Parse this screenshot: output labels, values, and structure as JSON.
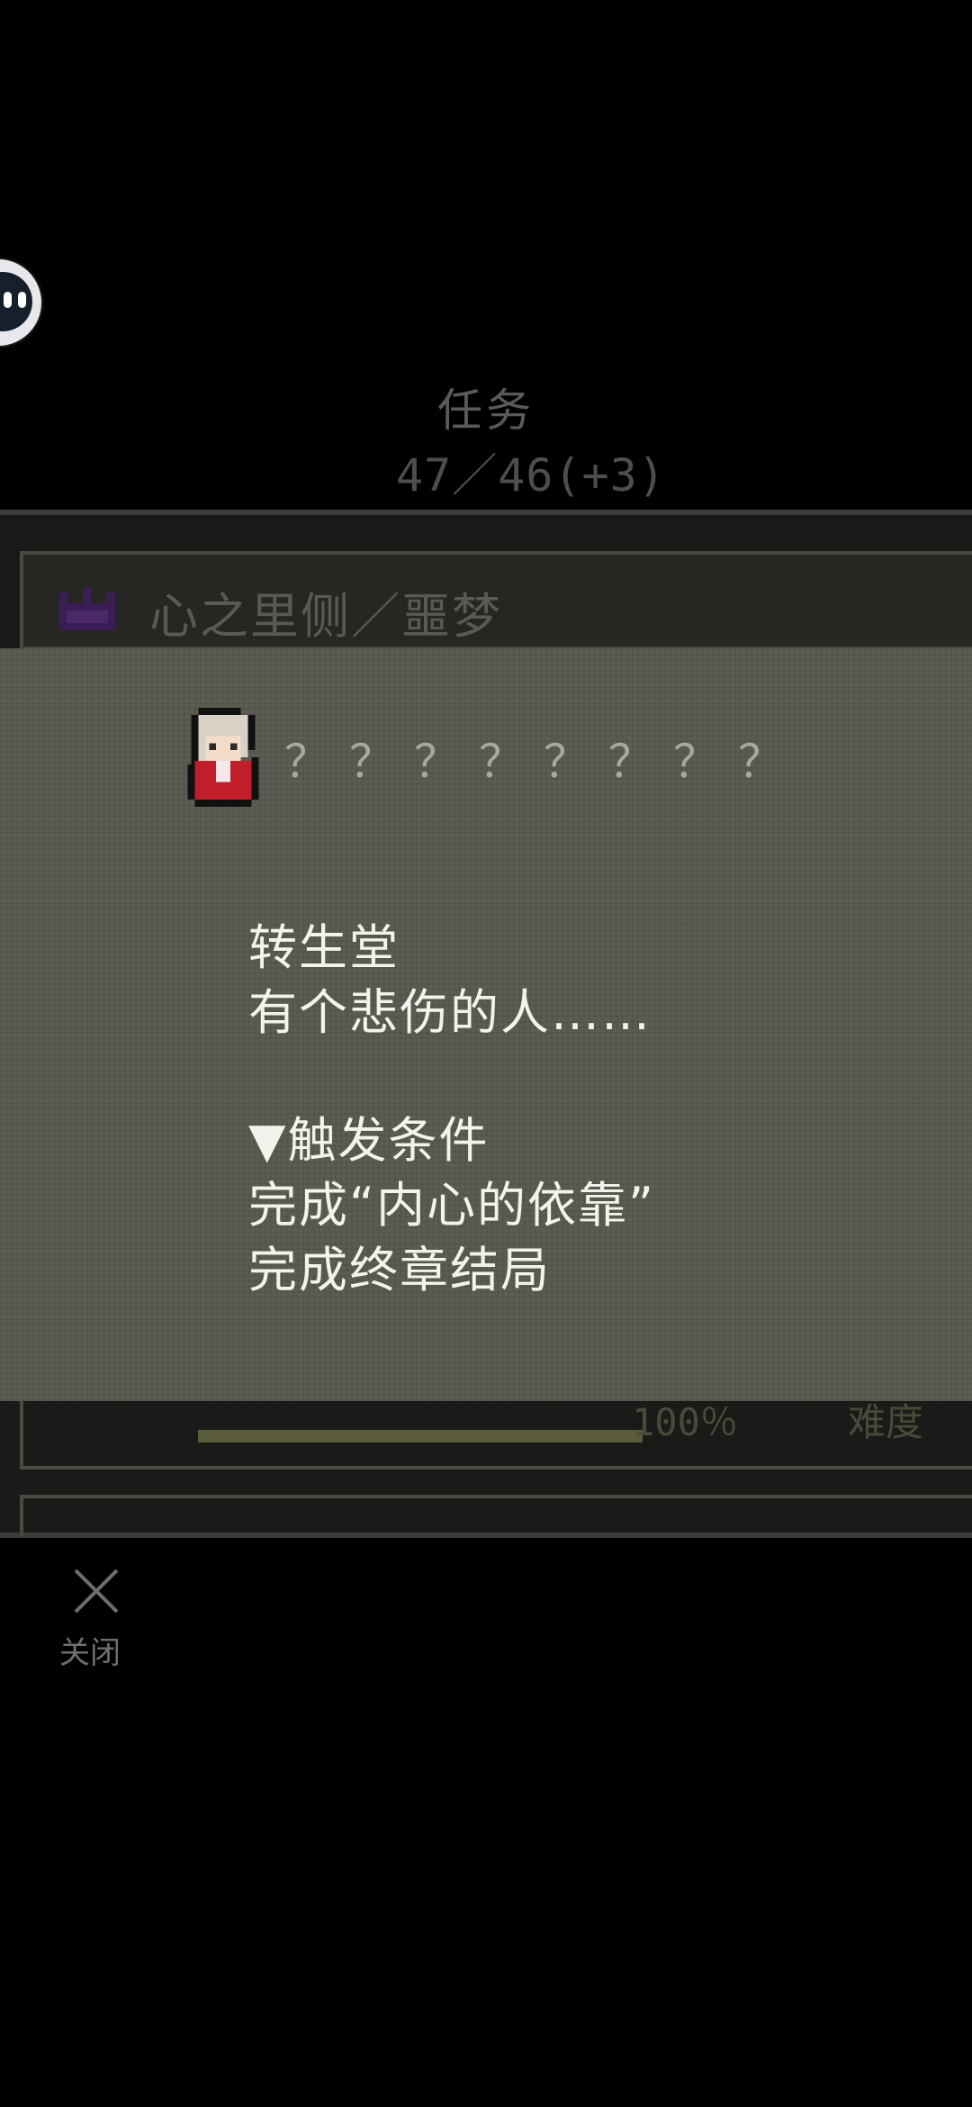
{
  "header": {
    "title": "任务",
    "count": "47／46(+3)"
  },
  "list": {
    "entry_title": "心之里侧／噩梦",
    "entry_icon": "crown-icon",
    "progress_percent": 100,
    "progress_label": "100％",
    "difficulty_label": "难度"
  },
  "detail": {
    "avatar_icon": "pixel-girl-avatar",
    "quest_name": "？？？？？？？？",
    "location": "转生堂",
    "description": "有个悲伤的人……",
    "condition_header": "▼触发条件",
    "condition_1": "完成“内心的依靠”",
    "condition_2": "完成终章结局"
  },
  "close": {
    "icon": "close-icon",
    "label": "关闭"
  },
  "colors": {
    "modal_bg": "#5d5c52",
    "panel_bg": "#1a1a18",
    "text_light": "#f3f3ee",
    "crown_purple": "#5a2d7a"
  }
}
